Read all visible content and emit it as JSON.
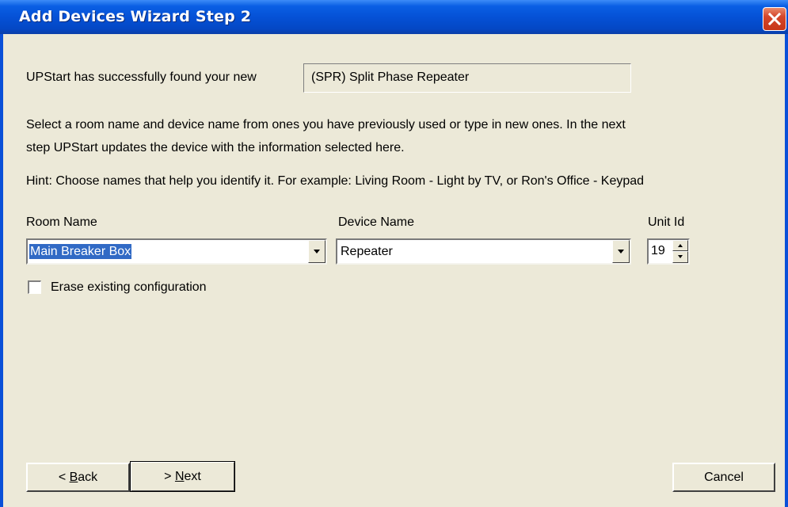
{
  "window": {
    "title": "Add Devices Wizard Step 2",
    "close_icon": "close-icon"
  },
  "found": {
    "label": "UPStart has successfully found your new",
    "device": "(SPR) Split Phase Repeater"
  },
  "instructions": {
    "line1": "Select a room name and device name from ones you have previously used or type in new ones.  In the next",
    "line2": "step UPStart updates the device with the information selected here.",
    "hint": "Hint: Choose names that help you identify it.  For example: Living Room - Light by TV, or Ron's Office - Keypad"
  },
  "room": {
    "label": "Room Name",
    "value": "Main Breaker Box"
  },
  "device": {
    "label": "Device Name",
    "value": "Repeater"
  },
  "unit": {
    "label": "Unit Id",
    "value": "19"
  },
  "erase": {
    "label": "Erase existing configuration",
    "checked": false
  },
  "buttons": {
    "back_prefix": "< ",
    "back_mnemonic": "B",
    "back_rest": "ack",
    "next_prefix": "> ",
    "next_mnemonic": "N",
    "next_rest": "ext",
    "cancel": "Cancel"
  }
}
